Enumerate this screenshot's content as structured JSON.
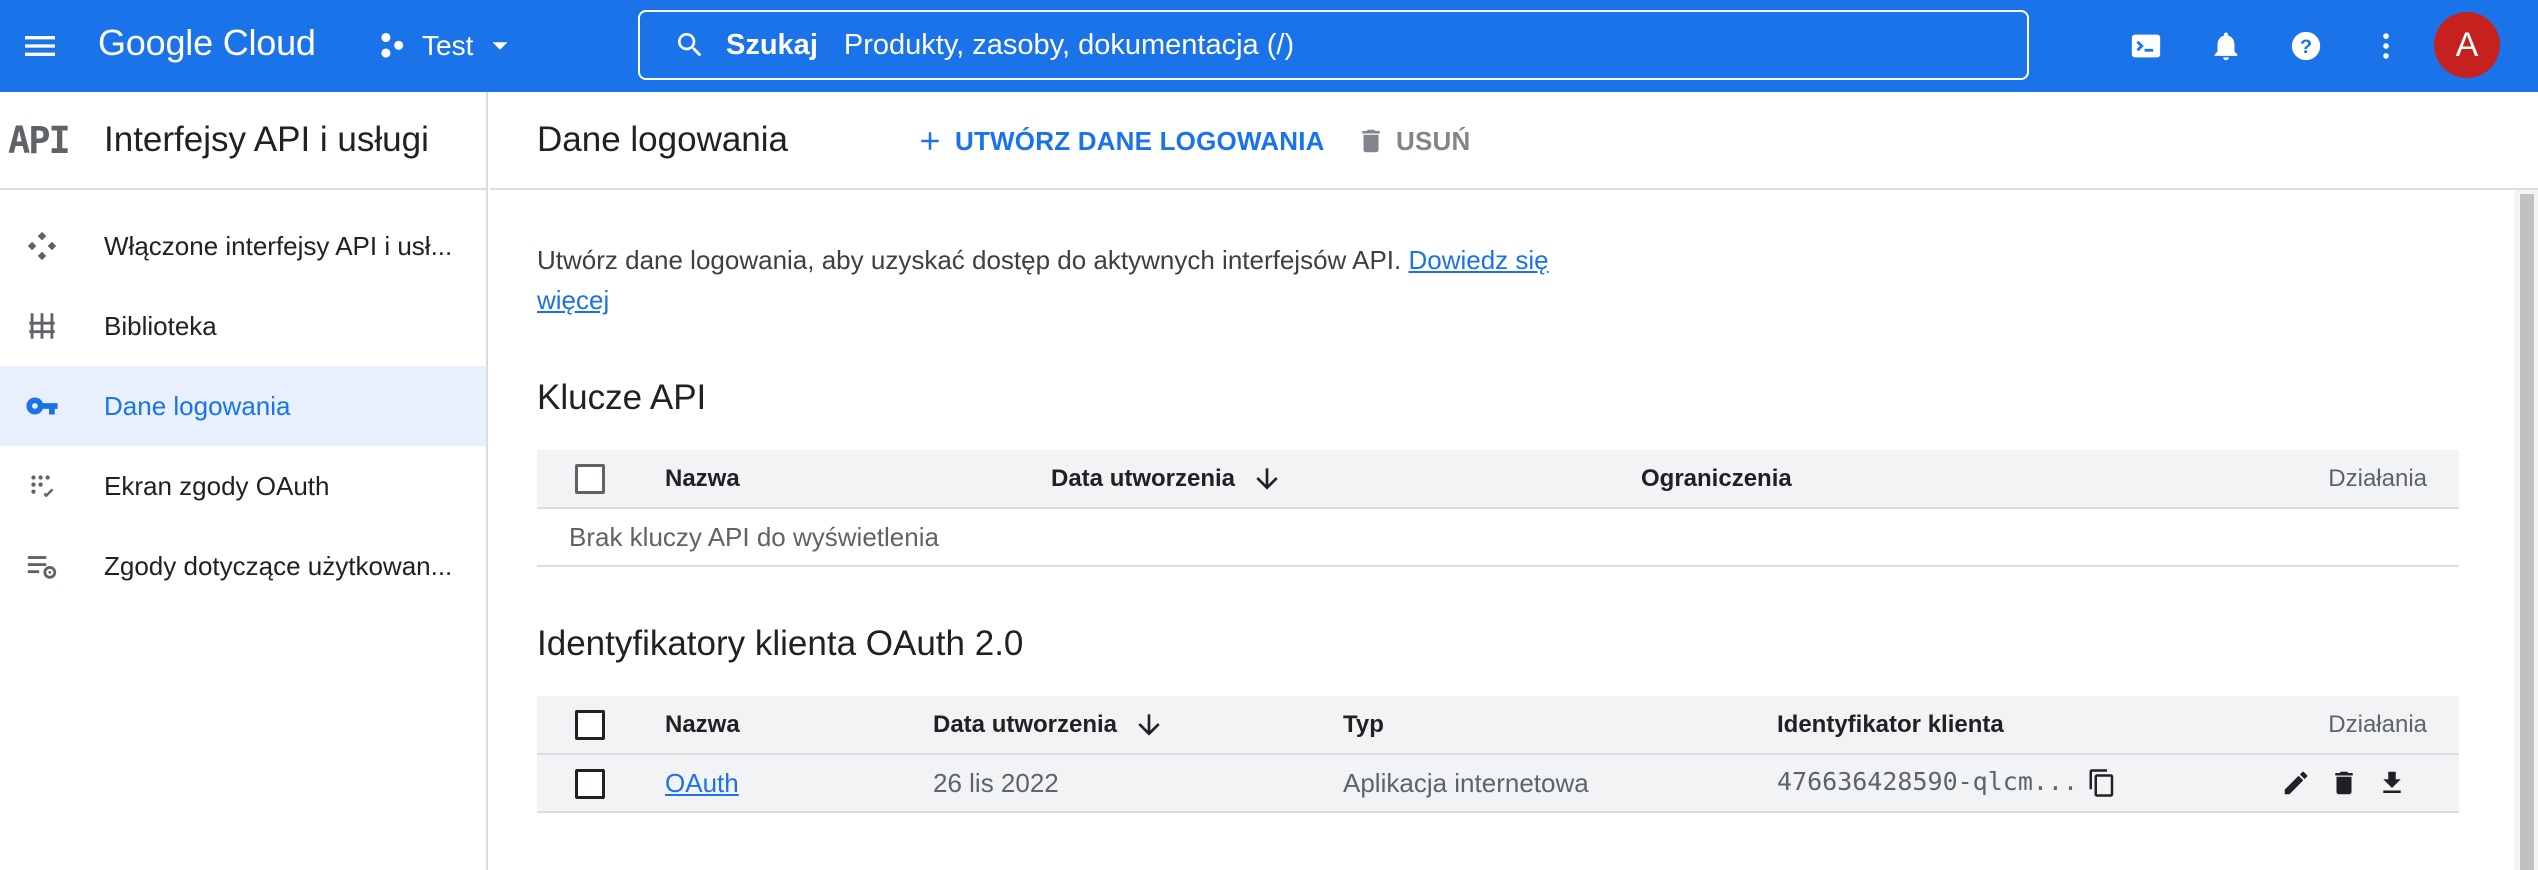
{
  "topbar": {
    "brand": "Google Cloud",
    "project": "Test",
    "search_label": "Szukaj",
    "search_placeholder": "Produkty, zasoby, dokumentacja (/)",
    "avatar_letter": "A",
    "icons": [
      "menu-icon",
      "project-icon",
      "dropdown-icon",
      "search-icon",
      "cloud-shell-icon",
      "notifications-icon",
      "help-icon",
      "more-vert-icon"
    ],
    "colors": {
      "bar": "#1a73e8",
      "avatar": "#c5221f"
    }
  },
  "sidebar": {
    "logo_text": "API",
    "title": "Interfejsy API i usługi",
    "items": [
      {
        "label": "Włączone interfejsy API i usł...",
        "icon": "enabled-apis-icon",
        "active": false
      },
      {
        "label": "Biblioteka",
        "icon": "library-icon",
        "active": false
      },
      {
        "label": "Dane logowania",
        "icon": "key-icon",
        "active": true
      },
      {
        "label": "Ekran zgody OAuth",
        "icon": "oauth-consent-icon",
        "active": false
      },
      {
        "label": "Zgody dotyczące użytkowan...",
        "icon": "settings-list-icon",
        "active": false
      }
    ]
  },
  "main": {
    "title": "Dane logowania",
    "create_label": "UTWÓRZ DANE LOGOWANIA",
    "delete_label": "USUŃ",
    "intro_text": "Utwórz dane logowania, aby uzyskać dostęp do aktywnych interfejsów API. ",
    "intro_link": "Dowiedz się więcej",
    "api_keys": {
      "title": "Klucze API",
      "columns": [
        "Nazwa",
        "Data utworzenia",
        "Ograniczenia",
        "Działania"
      ],
      "empty_text": "Brak kluczy API do wyświetlenia"
    },
    "oauth": {
      "title": "Identyfikatory klienta OAuth 2.0",
      "columns": [
        "Nazwa",
        "Data utworzenia",
        "Typ",
        "Identyfikator klienta",
        "Działania"
      ],
      "rows": [
        {
          "name": "OAuth",
          "created": "26 lis 2022",
          "type": "Aplikacja internetowa",
          "client_id": "476636428590-qlcm..."
        }
      ]
    }
  }
}
